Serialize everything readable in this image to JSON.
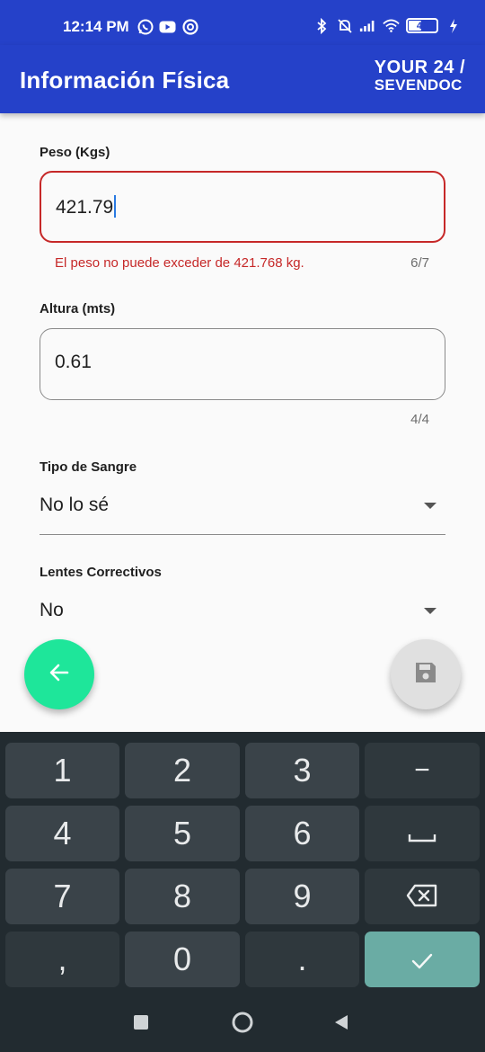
{
  "status_bar": {
    "time": "12:14 PM",
    "left_icons": [
      "whatsapp-icon",
      "youtube-icon",
      "data-saver-icon"
    ],
    "right_icons": [
      "bluetooth-icon",
      "alarm-off-icon",
      "signal-icon",
      "wifi-icon"
    ],
    "battery_level": "45"
  },
  "app_bar": {
    "title": "Información Física",
    "logo_line1": "YOUR 24 /",
    "logo_line2": "SEVENDOC"
  },
  "form": {
    "peso": {
      "label": "Peso (Kgs)",
      "value": "421.79",
      "error": "El peso no puede exceder de 421.768 kg.",
      "counter": "6/7"
    },
    "altura": {
      "label": "Altura (mts)",
      "value": "0.61",
      "counter": "4/4"
    },
    "tipo_sangre": {
      "label": "Tipo de Sangre",
      "value": "No lo sé"
    },
    "lentes": {
      "label": "Lentes Correctivos",
      "value": "No"
    }
  },
  "fabs": {
    "back_icon": "arrow-back-icon",
    "save_icon": "save-icon"
  },
  "keyboard": {
    "rows": [
      [
        "1",
        "2",
        "3",
        "−"
      ],
      [
        "4",
        "5",
        "6",
        "␣"
      ],
      [
        "7",
        "8",
        "9",
        "⌫"
      ],
      [
        ",",
        "0",
        ".",
        "✓"
      ]
    ]
  },
  "colors": {
    "primary": "#2541c9",
    "error": "#c62828",
    "fab_back": "#1ee69a",
    "keyboard_bg": "#222b30",
    "key_done": "#6aaca4"
  }
}
